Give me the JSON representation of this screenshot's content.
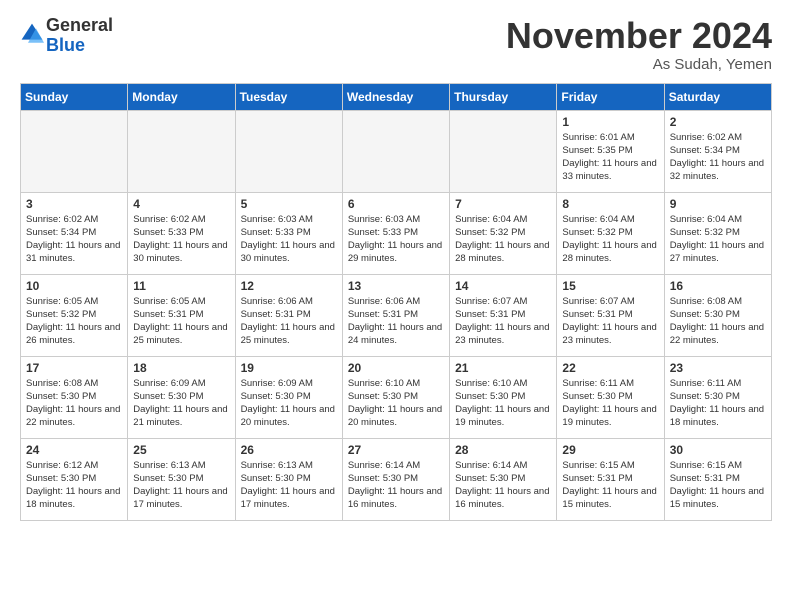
{
  "logo": {
    "general": "General",
    "blue": "Blue"
  },
  "header": {
    "month": "November 2024",
    "location": "As Sudah, Yemen"
  },
  "weekdays": [
    "Sunday",
    "Monday",
    "Tuesday",
    "Wednesday",
    "Thursday",
    "Friday",
    "Saturday"
  ],
  "weeks": [
    [
      {
        "day": "",
        "empty": true
      },
      {
        "day": "",
        "empty": true
      },
      {
        "day": "",
        "empty": true
      },
      {
        "day": "",
        "empty": true
      },
      {
        "day": "",
        "empty": true
      },
      {
        "day": "1",
        "sunrise": "6:01 AM",
        "sunset": "5:35 PM",
        "daylight": "11 hours and 33 minutes."
      },
      {
        "day": "2",
        "sunrise": "6:02 AM",
        "sunset": "5:34 PM",
        "daylight": "11 hours and 32 minutes."
      }
    ],
    [
      {
        "day": "3",
        "sunrise": "6:02 AM",
        "sunset": "5:34 PM",
        "daylight": "11 hours and 31 minutes."
      },
      {
        "day": "4",
        "sunrise": "6:02 AM",
        "sunset": "5:33 PM",
        "daylight": "11 hours and 30 minutes."
      },
      {
        "day": "5",
        "sunrise": "6:03 AM",
        "sunset": "5:33 PM",
        "daylight": "11 hours and 30 minutes."
      },
      {
        "day": "6",
        "sunrise": "6:03 AM",
        "sunset": "5:33 PM",
        "daylight": "11 hours and 29 minutes."
      },
      {
        "day": "7",
        "sunrise": "6:04 AM",
        "sunset": "5:32 PM",
        "daylight": "11 hours and 28 minutes."
      },
      {
        "day": "8",
        "sunrise": "6:04 AM",
        "sunset": "5:32 PM",
        "daylight": "11 hours and 28 minutes."
      },
      {
        "day": "9",
        "sunrise": "6:04 AM",
        "sunset": "5:32 PM",
        "daylight": "11 hours and 27 minutes."
      }
    ],
    [
      {
        "day": "10",
        "sunrise": "6:05 AM",
        "sunset": "5:32 PM",
        "daylight": "11 hours and 26 minutes."
      },
      {
        "day": "11",
        "sunrise": "6:05 AM",
        "sunset": "5:31 PM",
        "daylight": "11 hours and 25 minutes."
      },
      {
        "day": "12",
        "sunrise": "6:06 AM",
        "sunset": "5:31 PM",
        "daylight": "11 hours and 25 minutes."
      },
      {
        "day": "13",
        "sunrise": "6:06 AM",
        "sunset": "5:31 PM",
        "daylight": "11 hours and 24 minutes."
      },
      {
        "day": "14",
        "sunrise": "6:07 AM",
        "sunset": "5:31 PM",
        "daylight": "11 hours and 23 minutes."
      },
      {
        "day": "15",
        "sunrise": "6:07 AM",
        "sunset": "5:31 PM",
        "daylight": "11 hours and 23 minutes."
      },
      {
        "day": "16",
        "sunrise": "6:08 AM",
        "sunset": "5:30 PM",
        "daylight": "11 hours and 22 minutes."
      }
    ],
    [
      {
        "day": "17",
        "sunrise": "6:08 AM",
        "sunset": "5:30 PM",
        "daylight": "11 hours and 22 minutes."
      },
      {
        "day": "18",
        "sunrise": "6:09 AM",
        "sunset": "5:30 PM",
        "daylight": "11 hours and 21 minutes."
      },
      {
        "day": "19",
        "sunrise": "6:09 AM",
        "sunset": "5:30 PM",
        "daylight": "11 hours and 20 minutes."
      },
      {
        "day": "20",
        "sunrise": "6:10 AM",
        "sunset": "5:30 PM",
        "daylight": "11 hours and 20 minutes."
      },
      {
        "day": "21",
        "sunrise": "6:10 AM",
        "sunset": "5:30 PM",
        "daylight": "11 hours and 19 minutes."
      },
      {
        "day": "22",
        "sunrise": "6:11 AM",
        "sunset": "5:30 PM",
        "daylight": "11 hours and 19 minutes."
      },
      {
        "day": "23",
        "sunrise": "6:11 AM",
        "sunset": "5:30 PM",
        "daylight": "11 hours and 18 minutes."
      }
    ],
    [
      {
        "day": "24",
        "sunrise": "6:12 AM",
        "sunset": "5:30 PM",
        "daylight": "11 hours and 18 minutes."
      },
      {
        "day": "25",
        "sunrise": "6:13 AM",
        "sunset": "5:30 PM",
        "daylight": "11 hours and 17 minutes."
      },
      {
        "day": "26",
        "sunrise": "6:13 AM",
        "sunset": "5:30 PM",
        "daylight": "11 hours and 17 minutes."
      },
      {
        "day": "27",
        "sunrise": "6:14 AM",
        "sunset": "5:30 PM",
        "daylight": "11 hours and 16 minutes."
      },
      {
        "day": "28",
        "sunrise": "6:14 AM",
        "sunset": "5:30 PM",
        "daylight": "11 hours and 16 minutes."
      },
      {
        "day": "29",
        "sunrise": "6:15 AM",
        "sunset": "5:31 PM",
        "daylight": "11 hours and 15 minutes."
      },
      {
        "day": "30",
        "sunrise": "6:15 AM",
        "sunset": "5:31 PM",
        "daylight": "11 hours and 15 minutes."
      }
    ]
  ]
}
